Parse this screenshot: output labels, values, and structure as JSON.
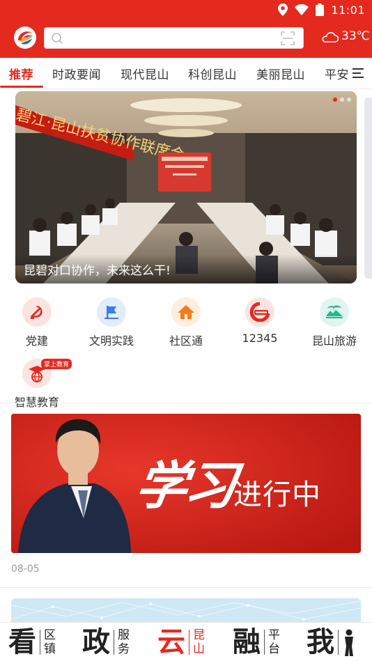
{
  "status_bar": {
    "time": "11:01"
  },
  "search": {
    "value": "",
    "placeholder": ""
  },
  "weather": {
    "temperature": "33℃"
  },
  "tabs": [
    {
      "label": "推荐",
      "active": true
    },
    {
      "label": "时政要闻",
      "active": false
    },
    {
      "label": "现代昆山",
      "active": false
    },
    {
      "label": "科创昆山",
      "active": false
    },
    {
      "label": "美丽昆山",
      "active": false
    },
    {
      "label": "平安",
      "active": false
    }
  ],
  "banner": {
    "caption": "昆碧对口协作，未来这么干!",
    "slide_count": 3,
    "active_slide": 1,
    "photo_text": "碧江·昆山扶贫协作联席会"
  },
  "shortcuts": [
    {
      "label": "党建",
      "icon": "party-emblem-icon"
    },
    {
      "label": "文明实践",
      "icon": "flag-icon"
    },
    {
      "label": "社区通",
      "icon": "house-icon"
    },
    {
      "label": "12345",
      "icon": "hotline-12345-icon"
    },
    {
      "label": "昆山旅游",
      "icon": "island-icon"
    },
    {
      "label": "智慧教育",
      "icon": "graduation-globe-icon",
      "badge": "掌上教育"
    }
  ],
  "feature": {
    "title": "学习",
    "subtitle": "进行中",
    "date": "08-05"
  },
  "bottom_nav": [
    {
      "big": "看",
      "small": [
        "区",
        "镇"
      ],
      "active": false
    },
    {
      "big": "政",
      "small": [
        "服",
        "务"
      ],
      "active": false
    },
    {
      "big": "云",
      "small": [
        "昆",
        "山"
      ],
      "active": true
    },
    {
      "big": "融",
      "small": [
        "平",
        "台"
      ],
      "active": false
    },
    {
      "big": "我",
      "small": [],
      "active": false
    }
  ],
  "colors": {
    "brand_red": "#e42a1f",
    "text_dark": "#333333",
    "muted": "#999999"
  }
}
